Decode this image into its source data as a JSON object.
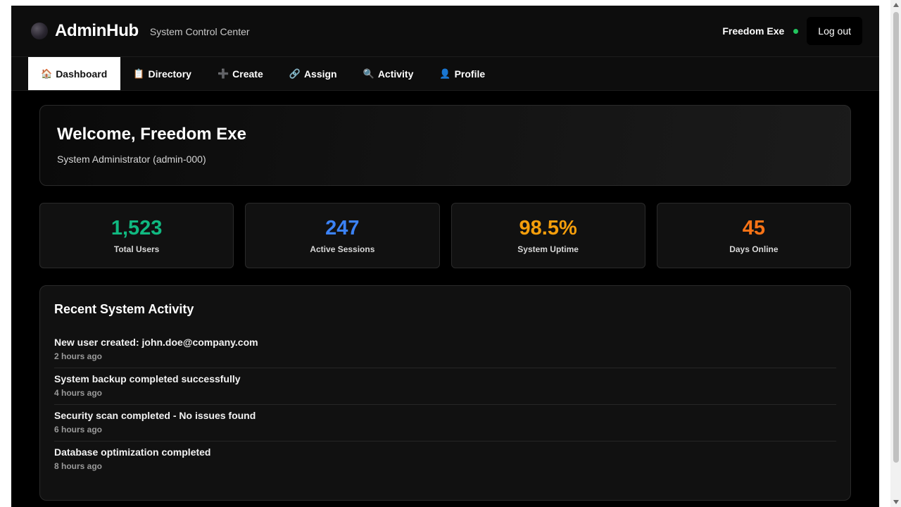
{
  "header": {
    "brand": "AdminHub",
    "subtitle": "System Control Center",
    "user_name": "Freedom Exe",
    "logout_label": "Log out",
    "status_color": "#22c55e"
  },
  "nav": {
    "tabs": [
      {
        "icon": "🏠",
        "icon_name": "home-icon",
        "label": "Dashboard",
        "active": true
      },
      {
        "icon": "📋",
        "icon_name": "directory-icon",
        "label": "Directory"
      },
      {
        "icon": "➕",
        "icon_name": "plus-icon",
        "label": "Create"
      },
      {
        "icon": "🔗",
        "icon_name": "link-icon",
        "label": "Assign"
      },
      {
        "icon": "🔍",
        "icon_name": "activity-icon",
        "label": "Activity"
      },
      {
        "icon": "👤",
        "icon_name": "profile-icon",
        "label": "Profile"
      }
    ]
  },
  "welcome": {
    "title": "Welcome, Freedom Exe",
    "role": "System Administrator (admin-000)"
  },
  "stats": [
    {
      "value": "1,523",
      "label": "Total Users",
      "color": "#10b981"
    },
    {
      "value": "247",
      "label": "Active Sessions",
      "color": "#3b82f6"
    },
    {
      "value": "98.5%",
      "label": "System Uptime",
      "color": "#f59e0b"
    },
    {
      "value": "45",
      "label": "Days Online",
      "color": "#f97316"
    }
  ],
  "activity": {
    "title": "Recent System Activity",
    "items": [
      {
        "text": "New user created: john.doe@company.com",
        "time": "2 hours ago"
      },
      {
        "text": "System backup completed successfully",
        "time": "4 hours ago"
      },
      {
        "text": "Security scan completed - No issues found",
        "time": "6 hours ago"
      },
      {
        "text": "Database optimization completed",
        "time": "8 hours ago"
      }
    ]
  }
}
